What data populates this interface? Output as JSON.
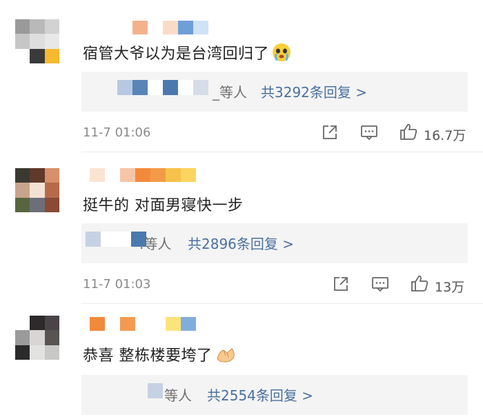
{
  "comments": [
    {
      "text": "宿管大爷以为是台湾回归了",
      "emoji_icon": "crying-face-emoji",
      "replies_names": "_等人",
      "replies_link": "共3292条回复 >",
      "time": "11-7 01:06",
      "likes": "16.7万"
    },
    {
      "text": "挺牛的 对面男寝快一步",
      "replies_names": ".等人",
      "replies_link": "共2896条回复 >",
      "time": "11-7 01:03",
      "likes": "13万"
    },
    {
      "text": "恭喜 整栋楼要垮了",
      "emoji_icon": "handshake-emoji",
      "replies_names": "等人",
      "replies_link": "共2554条回复 >"
    }
  ],
  "colors": {
    "link": "#4a6fa0",
    "meta": "#8a8a8a",
    "reply_bg": "#f4f4f4"
  }
}
